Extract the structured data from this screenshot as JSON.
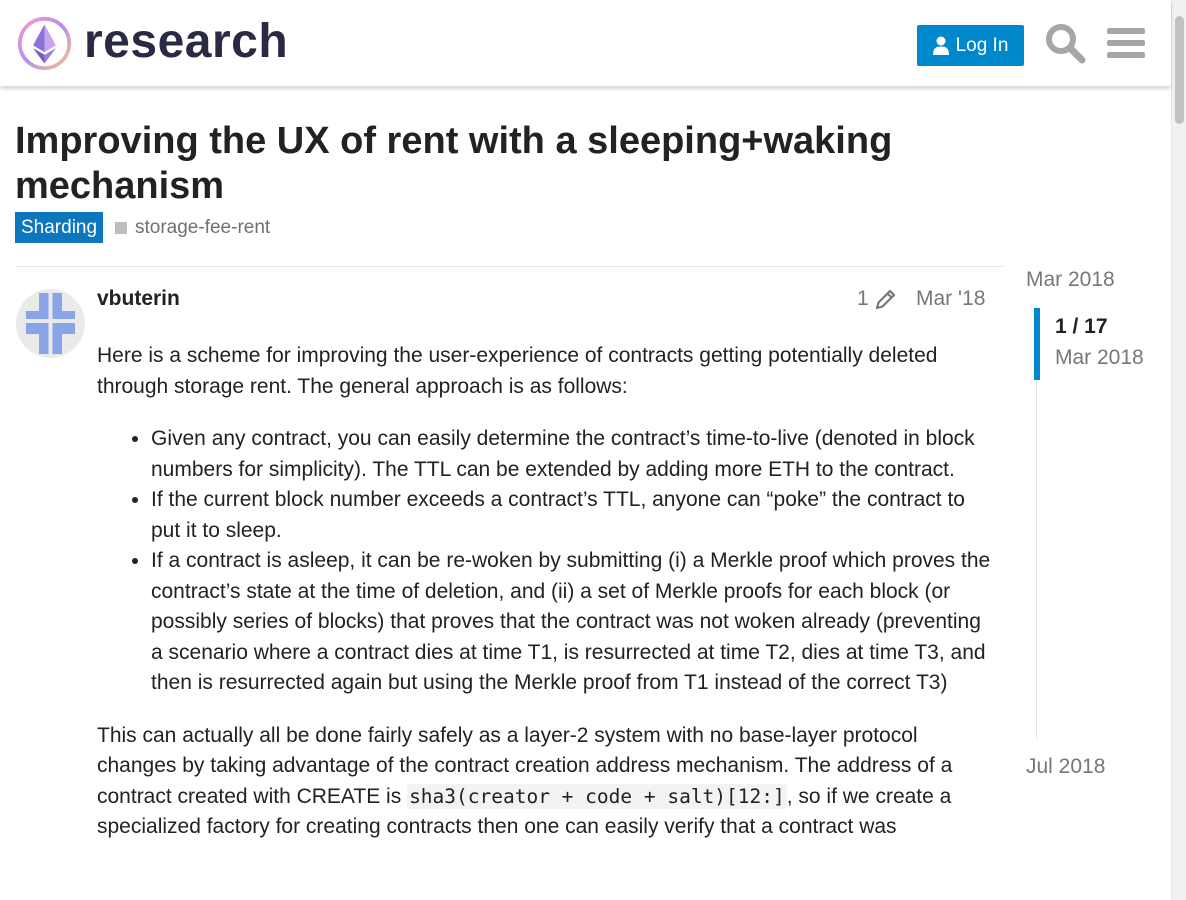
{
  "header": {
    "site_name": "research",
    "login_label": "Log In",
    "icons": [
      "ethereum-logo-icon",
      "user-icon",
      "search-icon",
      "hamburger-menu-icon"
    ]
  },
  "topic": {
    "title": "Improving the UX of rent with a sleeping+waking mechanism",
    "category": "Sharding",
    "tag": "storage-fee-rent"
  },
  "post": {
    "username": "vbuterin",
    "edit_count": "1",
    "date": "Mar '18",
    "intro": "Here is a scheme for improving the user-experience of contracts getting potentially deleted through storage rent. The general approach is as follows:",
    "bullets": [
      "Given any contract, you can easily determine the contract’s time-to-live (denoted in block numbers for simplicity). The TTL can be extended by adding more ETH to the contract.",
      "If the current block number exceeds a contract’s TTL, anyone can “poke” the contract to put it to sleep.",
      "If a contract is asleep, it can be re-woken by submitting (i) a Merkle proof which proves the contract’s state at the time of deletion, and (ii) a set of Merkle proofs for each block (or possibly series of blocks) that proves that the contract was not woken already (preventing a scenario where a contract dies at time T1, is resurrected at time T2, dies at time T3, and then is resurrected again but using the Merkle proof from T1 instead of the correct T3)"
    ],
    "para2_a": "This can actually all be done fairly safely as a layer-2 system with no base-layer protocol changes by taking advantage of the contract creation address mechanism. The address of a contract created with CREATE is ",
    "para2_code": "sha3(creator + code + salt)[12:]",
    "para2_b": ", so if we create a specialized factory for creating contracts then one can easily verify that a contract was"
  },
  "timeline": {
    "start_label": "Mar 2018",
    "position": "1 / 17",
    "current_date": "Mar 2018",
    "end_label": "Jul 2018"
  },
  "colors": {
    "accent": "#0088cc",
    "category": "#0e76bd",
    "muted_text": "#777777"
  }
}
